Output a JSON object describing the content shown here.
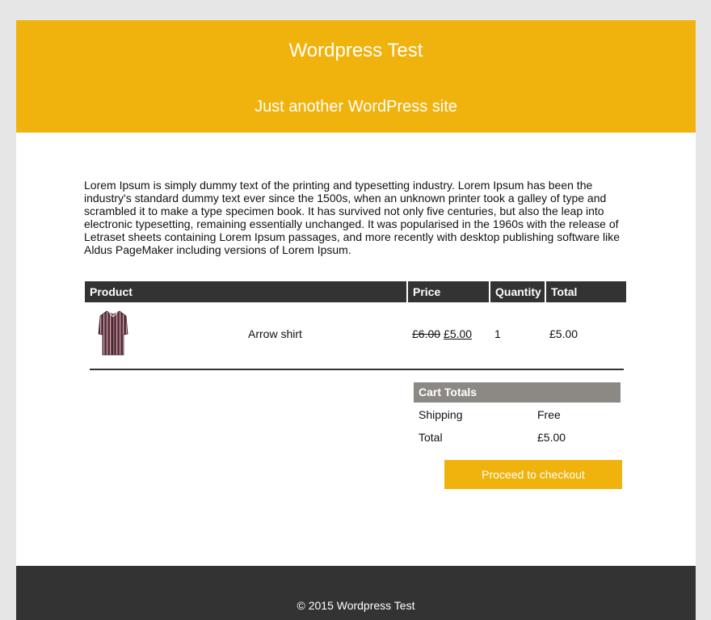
{
  "site": {
    "title": "Wordpress Test",
    "description": "Just another WordPress site"
  },
  "content": {
    "intro": "Lorem Ipsum is simply dummy text of the printing and typesetting industry. Lorem Ipsum has been the industry's standard dummy text ever since the 1500s, when an unknown printer took a galley of type and scrambled it to make a type specimen book. It has survived not only five centuries, but also the leap into electronic typesetting, remaining essentially unchanged. It was popularised in the 1960s with the release of Letraset sheets containing Lorem Ipsum passages, and more recently with desktop publishing software like Aldus PageMaker including versions of Lorem Ipsum."
  },
  "cart": {
    "headers": {
      "product": "Product",
      "price": "Price",
      "quantity": "Quantity",
      "total": "Total"
    },
    "items": [
      {
        "name": "Arrow shirt",
        "price_old": "£6.00",
        "price_new": "£5.00",
        "quantity": "1",
        "total": "£5.00",
        "image_icon": "striped-shirt-image"
      }
    ]
  },
  "totals": {
    "heading": "Cart Totals",
    "shipping_label": "Shipping",
    "shipping_value": "Free",
    "total_label": "Total",
    "total_value": "£5.00"
  },
  "checkout_label": "Proceed to checkout",
  "footer": {
    "copyright": "© 2015 Wordpress Test"
  },
  "colors": {
    "accent": "#f0b20c",
    "dark": "#333333",
    "totals_header": "#8c8984",
    "background": "#e6e6e6"
  }
}
